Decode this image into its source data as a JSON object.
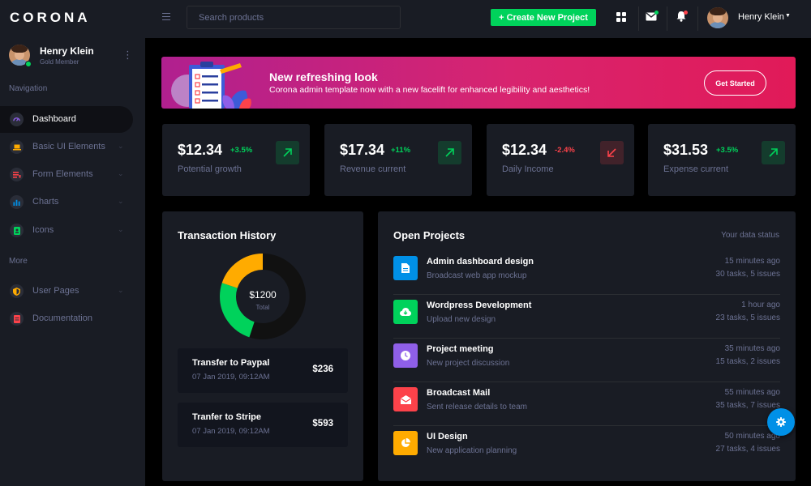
{
  "colors": {
    "success": "#00d25b",
    "danger": "#fc424a",
    "warning": "#ffab00",
    "primary": "#0090e7",
    "muted": "#6c7293",
    "card": "#191c24"
  },
  "brand": "CORONA",
  "sidebar": {
    "profile": {
      "name": "Henry Klein",
      "role": "Gold Member"
    },
    "nav_label": "Navigation",
    "more_label": "More",
    "items": [
      {
        "label": "Dashboard",
        "icon": "speedometer-icon",
        "color": "#8f5fe8"
      },
      {
        "label": "Basic UI Elements",
        "icon": "laptop-icon",
        "color": "#ffab00"
      },
      {
        "label": "Form Elements",
        "icon": "playlist-icon",
        "color": "#fc424a"
      },
      {
        "label": "Charts",
        "icon": "chart-bar-icon",
        "color": "#0090e7"
      },
      {
        "label": "Icons",
        "icon": "contacts-icon",
        "color": "#00d25b"
      }
    ],
    "more_items": [
      {
        "label": "User Pages",
        "icon": "security-icon",
        "color": "#ffab00"
      },
      {
        "label": "Documentation",
        "icon": "file-document-icon",
        "color": "#fc424a"
      }
    ]
  },
  "topbar": {
    "search_placeholder": "Search products",
    "create_label": "+ Create New Project",
    "user_name": "Henry Klein"
  },
  "banner": {
    "title": "New refreshing look",
    "text": "Corona admin template now with a new facelift for enhanced legibility and aesthetics!",
    "button": "Get Started"
  },
  "stats": [
    {
      "value": "$12.34",
      "change": "+3.5%",
      "label": "Potential growth",
      "trend": "up"
    },
    {
      "value": "$17.34",
      "change": "+11%",
      "label": "Revenue current",
      "trend": "up"
    },
    {
      "value": "$12.34",
      "change": "-2.4%",
      "label": "Daily Income",
      "trend": "down"
    },
    {
      "value": "$31.53",
      "change": "+3.5%",
      "label": "Expense current",
      "trend": "up"
    }
  ],
  "transactions": {
    "title": "Transaction History",
    "total_amount": "$1200",
    "total_label": "Total",
    "segments": [
      {
        "value": 55,
        "color": "#111111"
      },
      {
        "value": 25,
        "color": "#00d25b"
      },
      {
        "value": 20,
        "color": "#ffab00"
      }
    ],
    "items": [
      {
        "title": "Transfer to Paypal",
        "date": "07 Jan 2019, 09:12AM",
        "amount": "$236"
      },
      {
        "title": "Tranfer to Stripe",
        "date": "07 Jan 2019, 09:12AM",
        "amount": "$593"
      }
    ]
  },
  "projects": {
    "title": "Open Projects",
    "status_label": "Your data status",
    "items": [
      {
        "name": "Admin dashboard design",
        "desc": "Broadcast web app mockup",
        "time": "15 minutes ago",
        "tasks": "30 tasks, 5 issues",
        "icon": "file-document-icon",
        "color": "#0090e7"
      },
      {
        "name": "Wordpress Development",
        "desc": "Upload new design",
        "time": "1 hour ago",
        "tasks": "23 tasks, 5 issues",
        "icon": "cloud-download-icon",
        "color": "#00d25b"
      },
      {
        "name": "Project meeting",
        "desc": "New project discussion",
        "time": "35 minutes ago",
        "tasks": "15 tasks, 2 issues",
        "icon": "clock-icon",
        "color": "#8f5fe8"
      },
      {
        "name": "Broadcast Mail",
        "desc": "Sent release details to team",
        "time": "55 minutes ago",
        "tasks": "35 tasks, 7 issues",
        "icon": "email-open-icon",
        "color": "#fc424a"
      },
      {
        "name": "UI Design",
        "desc": "New application planning",
        "time": "50 minutes ago",
        "tasks": "27 tasks, 4 issues",
        "icon": "chart-pie-icon",
        "color": "#ffab00"
      }
    ]
  }
}
